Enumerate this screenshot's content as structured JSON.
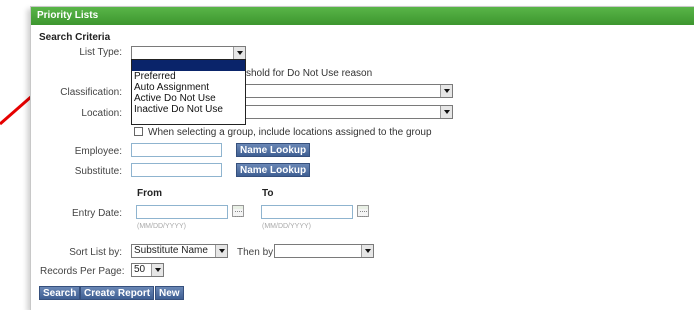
{
  "panel": {
    "title": "Priority Lists"
  },
  "search": {
    "title": "Search Criteria",
    "list_type_label": "List Type:",
    "list_type_value": "",
    "list_type_options": [
      "",
      "Preferred",
      "Auto Assignment",
      "Active Do Not Use",
      "Inactive Do Not Use"
    ],
    "threshold_partial": "shold for Do Not Use reason",
    "classification_label": "Classification:",
    "location_label": "Location:",
    "include_group_label": "When selecting a group, include locations assigned to the group",
    "employee_label": "Employee:",
    "substitute_label": "Substitute:",
    "name_lookup": "Name Lookup",
    "from_label": "From",
    "to_label": "To",
    "entry_date_label": "Entry Date:",
    "date_hint": "(MM/DD/YYYY)",
    "sort_label": "Sort List by:",
    "sort_value": "Substitute Name",
    "then_by_label": "Then by",
    "then_by_value": "",
    "records_label": "Records Per Page:",
    "records_value": "50"
  },
  "buttons": {
    "search": "Search",
    "create_report": "Create Report",
    "new": "New"
  },
  "colors": {
    "header_green": "#3d962f",
    "button_blue": "#4a6aa0",
    "annotation_red": "#e60000"
  }
}
